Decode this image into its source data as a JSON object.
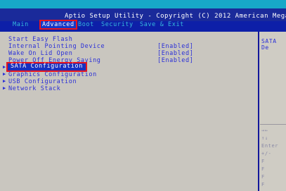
{
  "window": {
    "title": "Aptio Setup Utility - Copyright (C) 2012 American Megatr"
  },
  "tabs": [
    {
      "label": "Main"
    },
    {
      "label": "Advanced"
    },
    {
      "label": "Boot"
    },
    {
      "label": "Security"
    },
    {
      "label": "Save & Exit"
    }
  ],
  "menu": {
    "items": [
      {
        "label": "Start Easy Flash",
        "value": ""
      },
      {
        "label": "Internal Pointing Device",
        "value": "[Enabled]"
      },
      {
        "label": "Wake On Lid Open",
        "value": "[Enabled]"
      },
      {
        "label": "Power Off Energy Saving",
        "value": "[Enabled]"
      },
      {
        "label": "SATA Configuration",
        "value": ""
      },
      {
        "label": "Graphics Configuration",
        "value": ""
      },
      {
        "label": "USB Configuration",
        "value": ""
      },
      {
        "label": "Network Stack",
        "value": ""
      }
    ],
    "selected_label": "SATA Configuration"
  },
  "sidebar": {
    "title": "SATA De",
    "help_lines": [
      "→←",
      "↑↓",
      "Enter",
      "+/-",
      "F",
      "F",
      "F",
      "F",
      "ESC"
    ]
  },
  "colors": {
    "background": "#0d1fa8",
    "panel": "#c9c6bf",
    "title_bar": "#17a8c8",
    "highlight": "#e8151d"
  }
}
